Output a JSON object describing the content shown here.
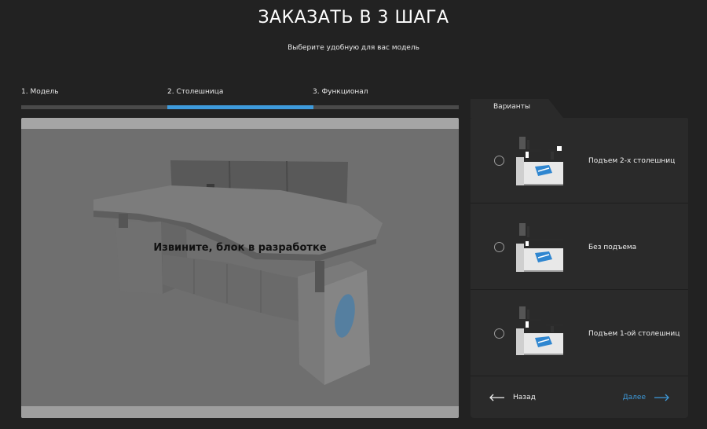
{
  "header": {
    "title": "ЗАКАЗАТЬ В 3 ШАГА",
    "subtitle": "Выберите удобную для вас модель"
  },
  "steps": {
    "items": [
      {
        "label": "1. Модель"
      },
      {
        "label": "2. Столешница"
      },
      {
        "label": "3. Функционал"
      }
    ],
    "active_index": 1,
    "active_color": "#3e9bdc"
  },
  "preview": {
    "message": "Извините, блок в разработке"
  },
  "variants": {
    "tab_label": "Варианты",
    "items": [
      {
        "label": "Подъем 2-х столешниц",
        "selected": false
      },
      {
        "label": "Без подъема",
        "selected": false
      },
      {
        "label": "Подъем 1-ой столешниц",
        "selected": false
      }
    ]
  },
  "navigation": {
    "back_label": "Назад",
    "next_label": "Далее",
    "back_icon": "arrow-left-icon",
    "next_icon": "arrow-right-icon"
  }
}
